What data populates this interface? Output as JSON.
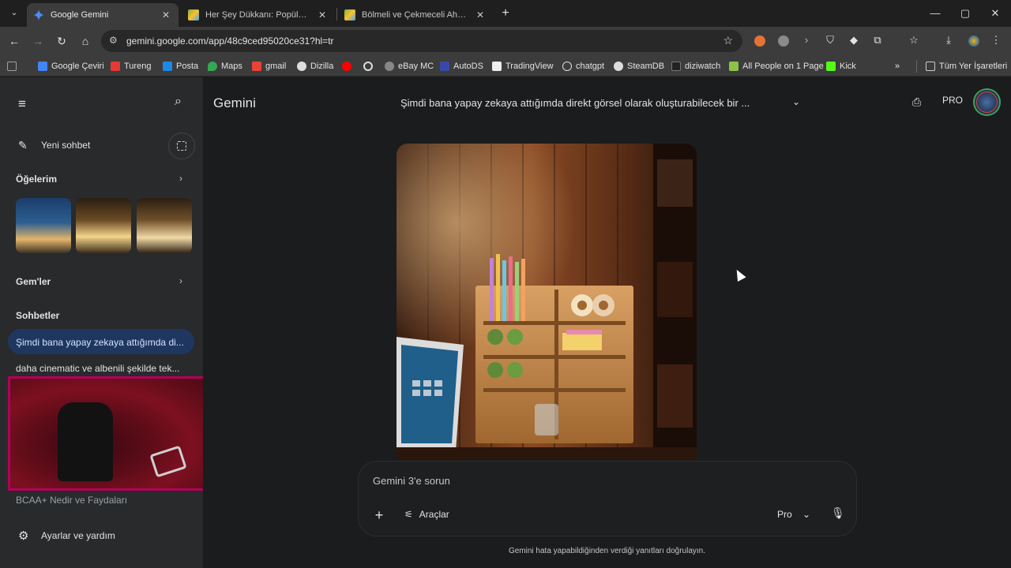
{
  "browser": {
    "tabs": [
      {
        "title": "Google Gemini",
        "icon": "gemini-sparkle-icon",
        "active": true
      },
      {
        "title": "Her Şey Dükkanı: Popüler Ürünl",
        "icon": "image-icon",
        "active": false
      },
      {
        "title": "Bölmeli ve Çekmeceli Ahşap Or",
        "icon": "image-icon",
        "active": false
      }
    ],
    "tab_close_glyph": "✕",
    "new_tab_glyph": "+",
    "window_controls": {
      "minimize": "—",
      "maximize": "▢",
      "close": "✕"
    },
    "url": "gemini.google.com/app/48c9ced95020ce31?hl=tr",
    "nav": {
      "back": "←",
      "forward": "→",
      "reload": "↻",
      "home": "⌂"
    },
    "bookmarks": [
      {
        "label": "",
        "icon": "apps-grid-icon",
        "color": "#9aa0a6"
      },
      {
        "label": "Google Çeviri",
        "icon": "translate-icon",
        "color": "#4285f4"
      },
      {
        "label": "Tureng",
        "icon": "tureng-icon",
        "color": "#e53935"
      },
      {
        "label": "Posta",
        "icon": "mail-icon",
        "color": "#1e88e5"
      },
      {
        "label": "Maps",
        "icon": "maps-icon",
        "color": "#34a853"
      },
      {
        "label": "gmail",
        "icon": "gmail-icon",
        "color": "#ea4335"
      },
      {
        "label": "Dizilla",
        "icon": "dizilla-icon",
        "color": "#dddddd"
      },
      {
        "label": "",
        "icon": "youtube-icon",
        "color": "#ff0000"
      },
      {
        "label": "",
        "icon": "circle-icon",
        "color": "#dddddd"
      },
      {
        "label": "eBay MC",
        "icon": "ebay-icon",
        "color": "#888888"
      },
      {
        "label": "AutoDS",
        "icon": "autods-icon",
        "color": "#3949ab"
      },
      {
        "label": "TradingView",
        "icon": "tradingview-icon",
        "color": "#eeeeee"
      },
      {
        "label": "chatgpt",
        "icon": "chatgpt-icon",
        "color": "#dddddd"
      },
      {
        "label": "SteamDB",
        "icon": "steamdb-icon",
        "color": "#dddddd"
      },
      {
        "label": "diziwatch",
        "icon": "diziwatch-icon",
        "color": "#222222"
      },
      {
        "label": "All People on 1 Page",
        "icon": "people-icon",
        "color": "#8bc34a"
      },
      {
        "label": "Kick",
        "icon": "kick-icon",
        "color": "#53fc18"
      }
    ],
    "bookmarks_overflow": "»",
    "all_bookmarks": "Tüm Yer İşaretleri"
  },
  "sidebar": {
    "menu_glyph": "≡",
    "search_glyph": "⌕",
    "new_chat": "Yeni sohbet",
    "my_items": "Öğelerim",
    "gems": "Gem'ler",
    "chats_heading": "Sohbetler",
    "chats": [
      "Şimdi bana yapay zekaya attığımda di...",
      "daha cinematic ve albenili şekilde tek...",
      "BCAA+ Nedir ve Faydaları"
    ],
    "settings": "Ayarlar ve yardım",
    "chevron": "›"
  },
  "main": {
    "brand": "Gemini",
    "conversation_title": "Şimdi bana yapay zekaya attığımda direkt görsel olarak oluşturabilecek bir ...",
    "title_chevron": "⌄",
    "plan_badge": "PRO",
    "input": {
      "placeholder": "Gemini 3'e sorun",
      "add": "+",
      "tools": "Araçlar",
      "mode": "Pro",
      "mode_chevron": "⌄",
      "mic": "🎙"
    },
    "disclaimer": "Gemini hata yapabildiğinden verdiği yanıtları doğrulayın."
  },
  "colors": {
    "accent_active_chat": "#1f3760",
    "sidebar_bg": "#282a2c",
    "main_bg": "#1b1c1d",
    "overlay_border": "#b3005b"
  }
}
